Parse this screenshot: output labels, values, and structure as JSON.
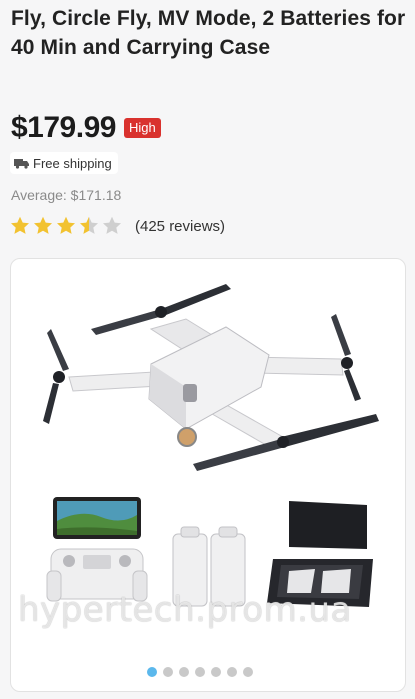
{
  "product": {
    "title": "Fly, Circle Fly, MV Mode, 2 Batteries for 40 Min and Carrying Case",
    "price": "$179.99",
    "price_badge": "High",
    "shipping": "Free shipping",
    "average": "Average: $171.18",
    "rating": 3.5,
    "reviews": "(425 reviews)"
  },
  "gallery": {
    "image_subject": "drone-with-controller-batteries-and-case",
    "watermark": "hypertech.prom.ua",
    "slide_count": 7,
    "active_slide": 1
  },
  "colors": {
    "price_badge": "#d9322e",
    "star": "#f2c230",
    "star_empty": "#cfcfcf",
    "active_dot": "#5bb8ec"
  }
}
